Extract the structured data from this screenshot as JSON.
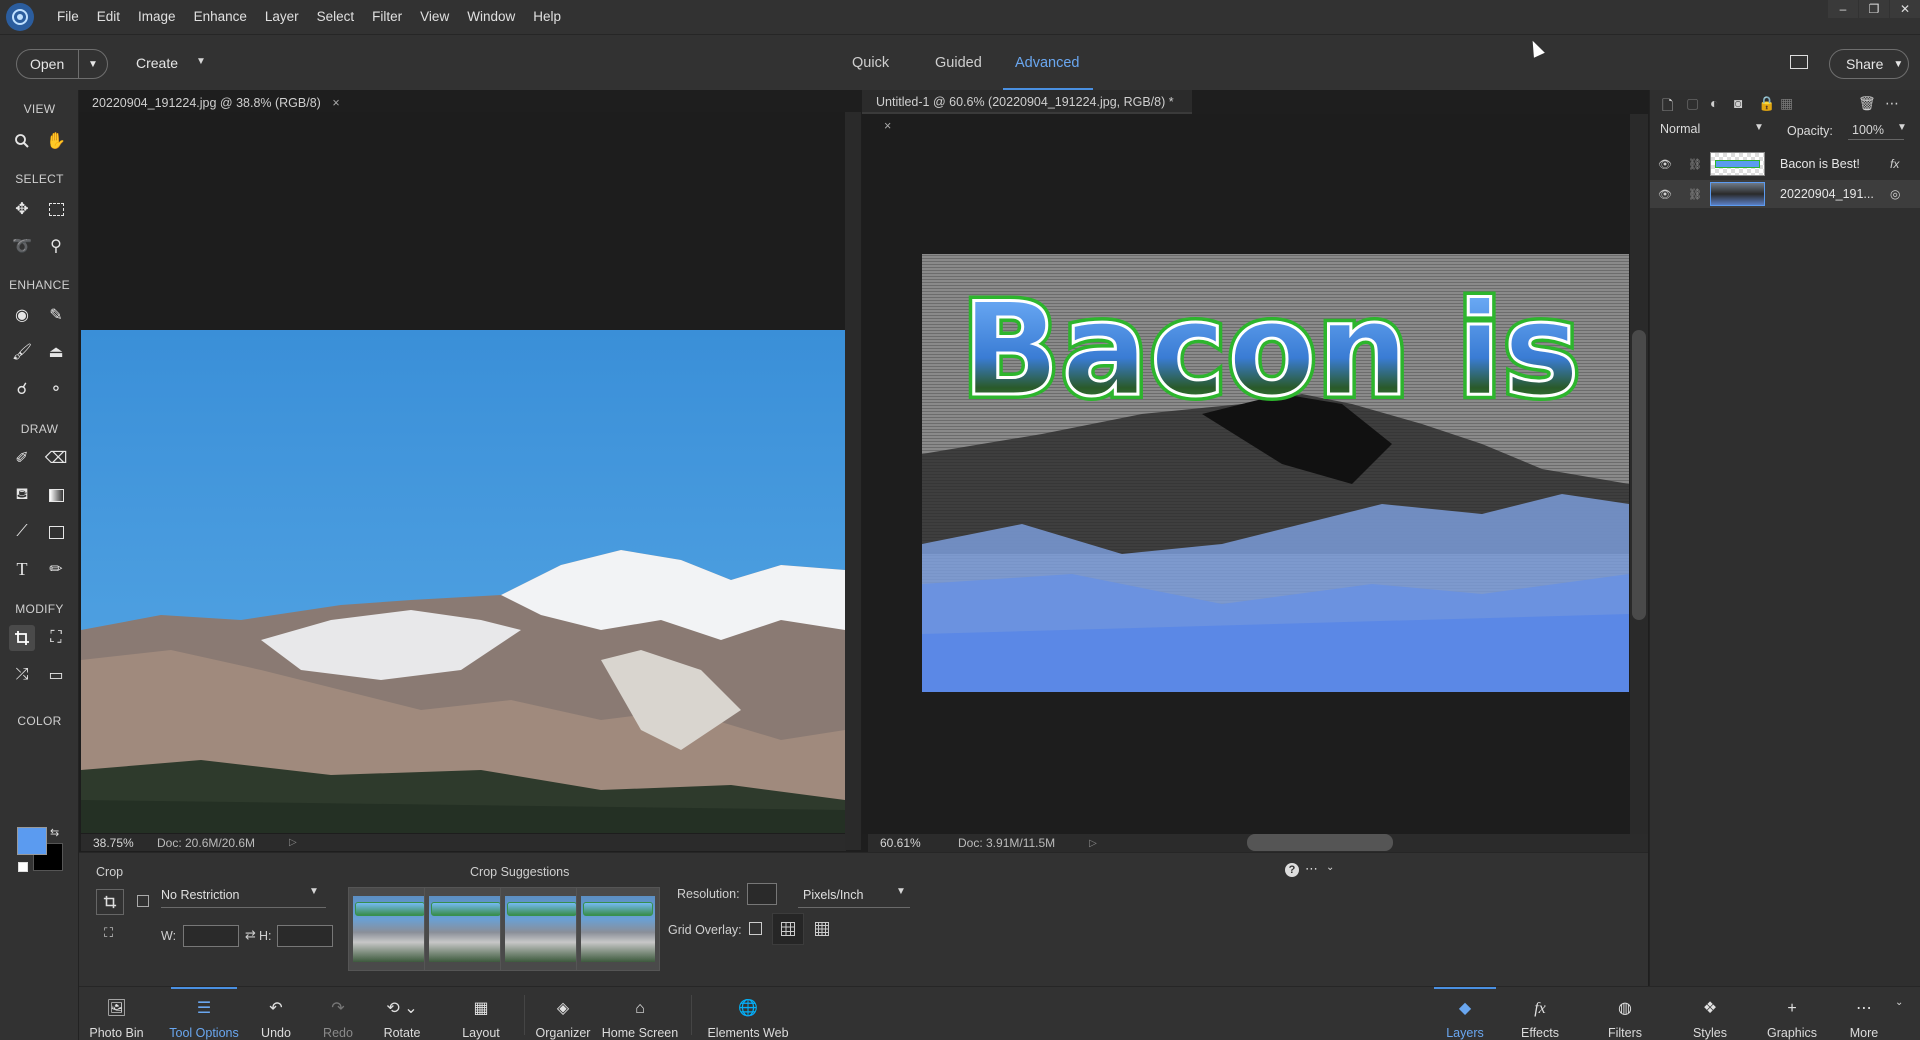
{
  "menubar": {
    "items": [
      "File",
      "Edit",
      "Image",
      "Enhance",
      "Layer",
      "Select",
      "Filter",
      "View",
      "Window",
      "Help"
    ],
    "window_controls": [
      "–",
      "❐",
      "✕"
    ]
  },
  "topbar": {
    "open_label": "Open",
    "create_label": "Create",
    "modes": [
      "Quick",
      "Guided",
      "Advanced"
    ],
    "active_mode": "Advanced",
    "share_label": "Share"
  },
  "toolbox": {
    "sections": [
      "VIEW",
      "SELECT",
      "ENHANCE",
      "DRAW",
      "MODIFY",
      "COLOR"
    ],
    "foreground_color": "#5b9bf0",
    "background_color": "#000000"
  },
  "doc1": {
    "tab_title": "20220904_191224.jpg @ 38.8% (RGB/8)",
    "zoom": "38.75%",
    "doc_size": "Doc: 20.6M/20.6M"
  },
  "doc2": {
    "tab_title": "Untitled-1 @ 60.6% (20220904_191224.jpg, RGB/8) *",
    "zoom": "60.61%",
    "doc_size": "Doc: 3.91M/11.5M",
    "overlay_text": "Bacon is"
  },
  "layers": {
    "blend_mode": "Normal",
    "opacity_label": "Opacity:",
    "opacity_value": "100%",
    "rows": [
      {
        "name": "Bacon is Best!",
        "fx": "fx"
      },
      {
        "name": "20220904_191..."
      }
    ]
  },
  "tool_options": {
    "tool_name": "Crop",
    "crop_suggestions_label": "Crop Suggestions",
    "restriction": "No Restriction",
    "w_label": "W:",
    "h_label": "H:",
    "resolution_label": "Resolution:",
    "resolution_unit": "Pixels/Inch",
    "grid_overlay_label": "Grid Overlay:"
  },
  "taskbar": {
    "left_items": [
      "Photo Bin",
      "Tool Options",
      "Undo",
      "Redo",
      "Rotate",
      "Layout",
      "Organizer",
      "Home Screen",
      "Elements Web"
    ],
    "right_items": [
      "Layers",
      "Effects",
      "Filters",
      "Styles",
      "Graphics",
      "More"
    ],
    "active_left": "Tool Options",
    "active_right": "Layers"
  },
  "colors": {
    "accent": "#4a90e2",
    "sky": "#3d96dc",
    "text_green_outline": "#2db52d"
  }
}
